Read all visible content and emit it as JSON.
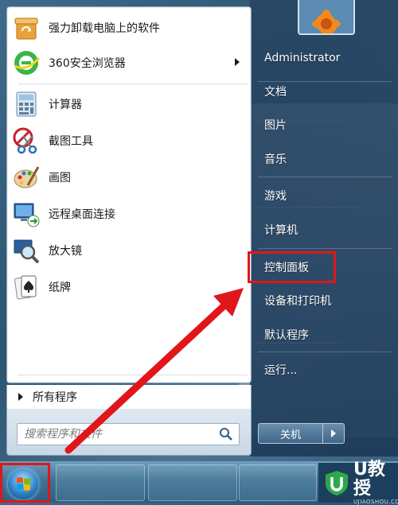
{
  "pinned_programs": [
    {
      "label": "强力卸载电脑上的软件",
      "icon": "uninstall-box-icon",
      "has_submenu": false
    },
    {
      "label": "360安全浏览器",
      "icon": "browser-360-icon",
      "has_submenu": true
    }
  ],
  "recent_programs": [
    {
      "label": "计算器",
      "icon": "calculator-icon"
    },
    {
      "label": "截图工具",
      "icon": "snipping-tool-icon"
    },
    {
      "label": "画图",
      "icon": "paint-palette-icon"
    },
    {
      "label": "远程桌面连接",
      "icon": "remote-desktop-icon"
    },
    {
      "label": "放大镜",
      "icon": "magnifier-icon"
    },
    {
      "label": "纸牌",
      "icon": "solitaire-icon"
    }
  ],
  "all_programs_label": "所有程序",
  "search": {
    "placeholder": "搜索程序和文件"
  },
  "user": {
    "name": "Administrator"
  },
  "right_items": [
    "文档",
    "图片",
    "音乐",
    "游戏",
    "计算机",
    "控制面板",
    "设备和打印机",
    "默认程序",
    "运行..."
  ],
  "highlighted_item": "控制面板",
  "shutdown_label": "关机",
  "brand": {
    "main": "U教授",
    "sub": "UJIAOSHOU.COM"
  },
  "colors": {
    "highlight": "#e0161a",
    "accent": "#2f83c8"
  }
}
